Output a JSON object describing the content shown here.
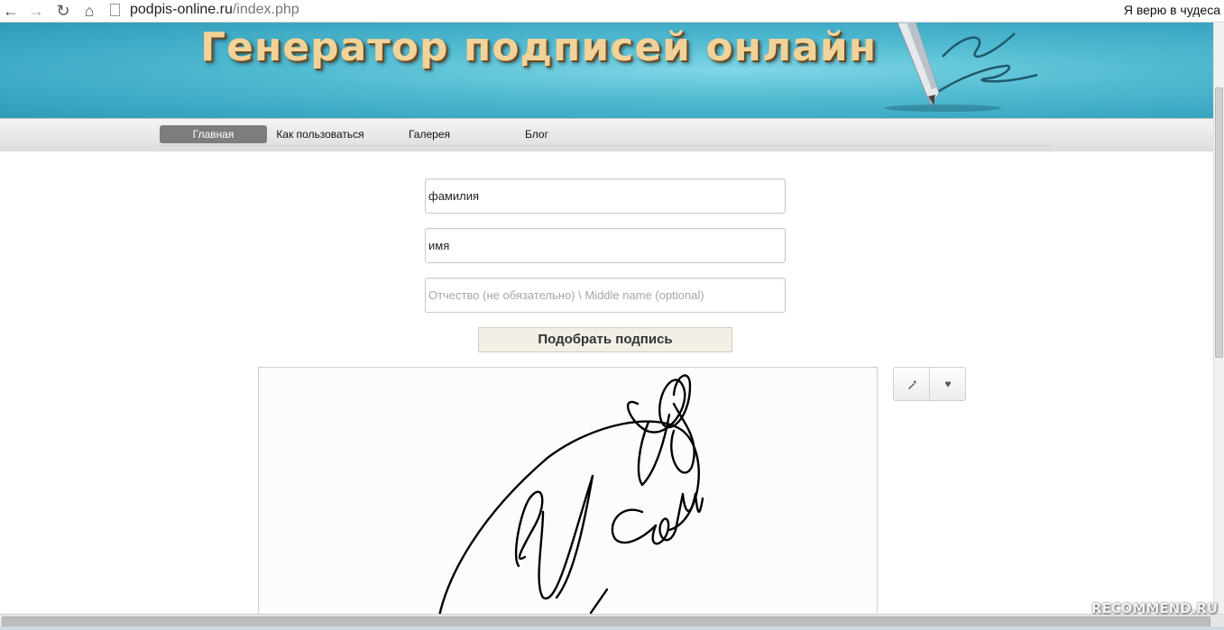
{
  "browser": {
    "url_domain": "podpis-online.ru",
    "url_path": "/index.php",
    "bookmark_label": "Я верю в чудеса",
    "icons": [
      "back-arrow-icon",
      "forward-arrow-icon",
      "reload-icon",
      "home-icon",
      "page-icon"
    ]
  },
  "header": {
    "title": "Генератор подписей онлайн"
  },
  "menu": {
    "items": [
      {
        "label": "Главная",
        "active": true
      },
      {
        "label": "Как пользоваться",
        "active": false
      },
      {
        "label": "Галерея",
        "active": false
      },
      {
        "label": "Блог",
        "active": false
      }
    ]
  },
  "form": {
    "surname_value": "фамилия",
    "name_value": "имя",
    "middle_name_placeholder": "Отчество (не обязательно) \\ Middle name (optional)",
    "submit_label": "Подобрать подпись"
  },
  "tools": {
    "icons": [
      "wrench-icon",
      "heart-icon"
    ]
  },
  "watermark": "RECOMMEND.RU",
  "colors": {
    "banner": "#4fb9d0",
    "title": "#f1d39a",
    "active_menu": "#7d7d7d",
    "button_bg": "#f1efe6"
  }
}
